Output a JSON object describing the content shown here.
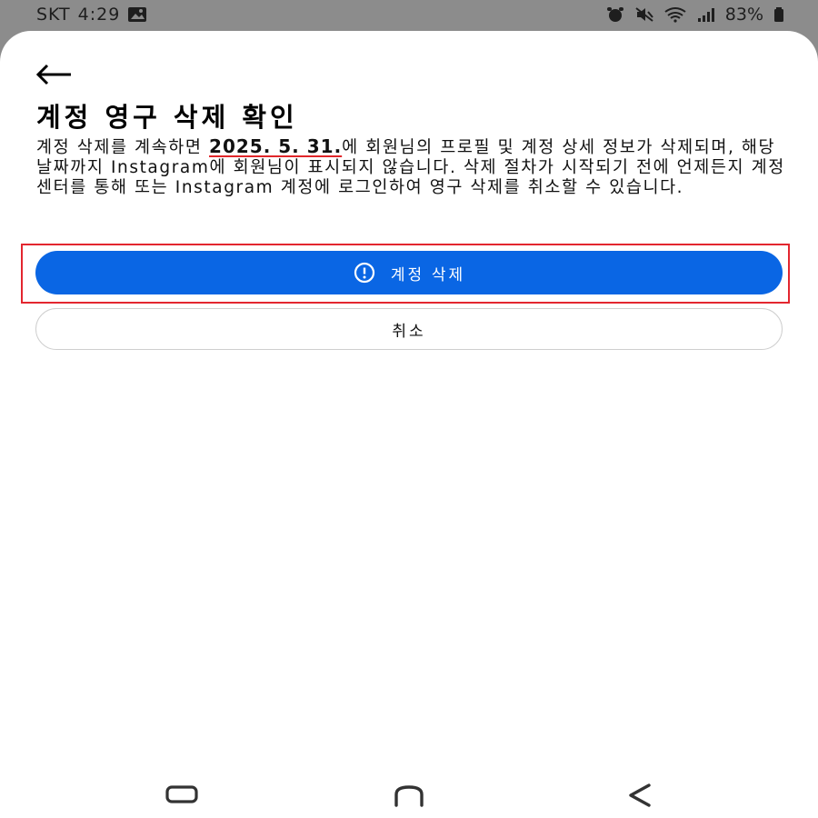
{
  "status_bar": {
    "carrier": "SKT",
    "time": "4:29",
    "battery": "83%"
  },
  "page": {
    "title": "계정 영구 삭제 확인",
    "description_before": "계정 삭제를 계속하면 ",
    "deletion_date": "2025. 5. 31.",
    "description_after": "에 회원님의 프로필 및 계정 상세 정보가 삭제되며, 해당 날짜까지 Instagram에 회원님이 표시되지 않습니다. 삭제 절차가 시작되기 전에 언제든지 계정 센터를 통해 또는 Instagram 계정에 로그인하여 영구 삭제를 취소할 수 있습니다."
  },
  "actions": {
    "delete_label": "계정 삭제",
    "cancel_label": "취소"
  },
  "colors": {
    "primary": "#0a66e4",
    "highlight_border": "#e3262f",
    "date_underline": "#e0262a"
  },
  "icons": {
    "back": "arrow-left-icon",
    "delete": "alert-circle-icon",
    "nav_recents": "recents-icon",
    "nav_home": "home-icon",
    "nav_back": "chevron-left-icon"
  }
}
